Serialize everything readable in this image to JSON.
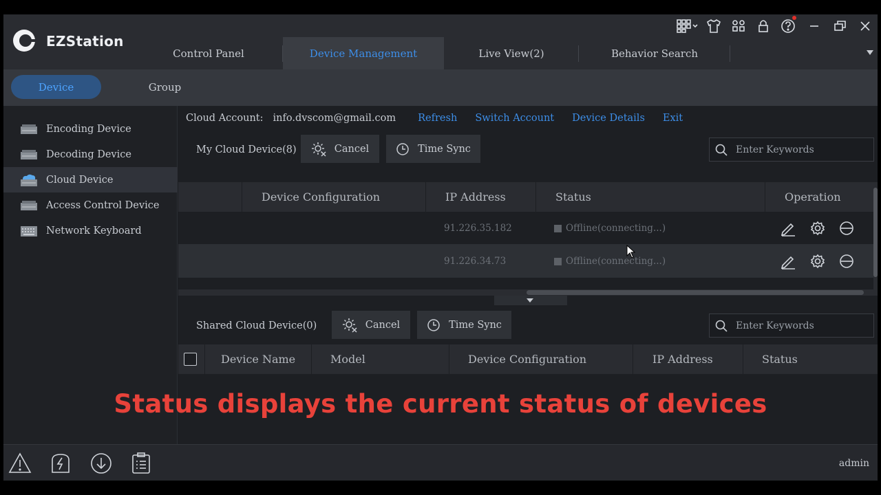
{
  "app": {
    "name": "EZStation"
  },
  "tabs": [
    "Control Panel",
    "Device Management",
    "Live View(2)",
    "Behavior Search"
  ],
  "subtabs": [
    "Device",
    "Group"
  ],
  "sidebar": {
    "items": [
      {
        "label": "Encoding Device"
      },
      {
        "label": "Decoding Device"
      },
      {
        "label": "Cloud Device"
      },
      {
        "label": "Access Control Device"
      },
      {
        "label": "Network Keyboard"
      }
    ]
  },
  "account": {
    "label": "Cloud Account:",
    "email": "info.dvscom@gmail.com",
    "links": [
      "Refresh",
      "Switch Account",
      "Device Details",
      "Exit"
    ]
  },
  "my_cloud": {
    "title": "My Cloud Device(8)",
    "cancel": "Cancel",
    "time_sync": "Time Sync",
    "search_placeholder": "Enter Keywords",
    "columns": [
      "Device Configuration",
      "IP Address",
      "Status",
      "Operation"
    ],
    "rows": [
      {
        "ip": "91.226.35.182",
        "status": "Offline(connecting...)"
      },
      {
        "ip": "91.226.34.73",
        "status": "Offline(connecting...)"
      }
    ]
  },
  "shared_cloud": {
    "title": "Shared Cloud Device(0)",
    "cancel": "Cancel",
    "time_sync": "Time Sync",
    "search_placeholder": "Enter Keywords",
    "columns": [
      "Device Name",
      "Model",
      "Device Configuration",
      "IP Address",
      "Status"
    ]
  },
  "caption": "Status displays the current status of devices",
  "footer": {
    "user": "admin"
  },
  "colors": {
    "accent": "#3d8ee8",
    "caption": "#e8423a"
  }
}
